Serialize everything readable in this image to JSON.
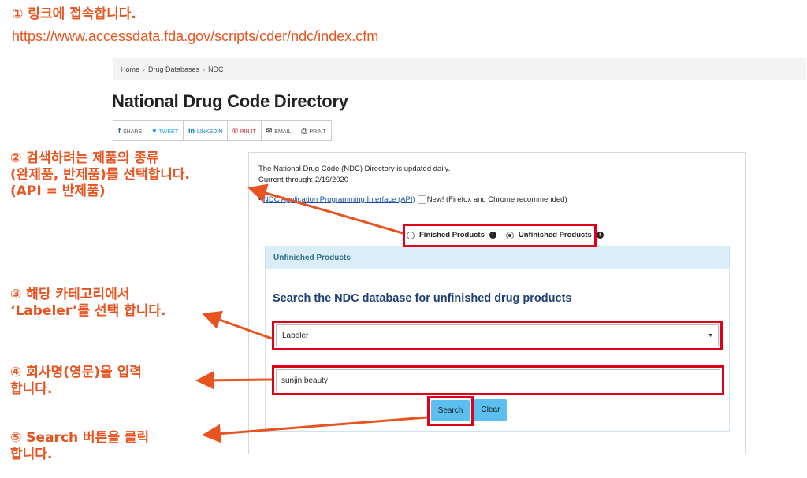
{
  "annotations": {
    "step1_title": "① 링크에 접속합니다.",
    "step1_url": "https://www.accessdata.fda.gov/scripts/cder/ndc/index.cfm",
    "step2": "② 검색하려는 제품의 종류\n(완제품, 반제품)를 선택합니다.\n(API = 반제품)",
    "step3": "③ 해당 카테고리에서\n‘Labeler’를 선택 합니다.",
    "step4": "④ 회사명(영문)을 입력\n합니다.",
    "step5": "⑤ Search 버튼을 클릭\n합니다."
  },
  "breadcrumb": {
    "home": "Home",
    "sep": "›",
    "db": "Drug Databases",
    "current": "NDC"
  },
  "page_title": "National Drug Code Directory",
  "share": {
    "share": "SHARE",
    "tweet": "TWEET",
    "linkedin": "LINKEDIN",
    "pinit": "PIN IT",
    "email": "EMAIL",
    "print": "PRINT"
  },
  "info": {
    "updated": "The National Drug Code (NDC) Directory is updated daily.",
    "current_through": "Current through: 2/19/2020",
    "api_link": "NDC Application Programming Interface (API)",
    "new_alt": "New!",
    "browsers": "(Firefox and Chrome recommended)"
  },
  "product_type": {
    "finished": "Finished Products",
    "unfinished": "Unfinished Products",
    "selected": "Unfinished Products"
  },
  "search_panel": {
    "header": "Unfinished Products",
    "heading": "Search the NDC database for unfinished drug products",
    "select_value": "Labeler",
    "input_value": "sunjin beauty",
    "search_button": "Search",
    "clear_button": "Clear"
  },
  "colors": {
    "annotation": "#e8541f",
    "highlight": "#e0001a",
    "button": "#5bc0f0",
    "panel_header": "#dbeef7"
  }
}
